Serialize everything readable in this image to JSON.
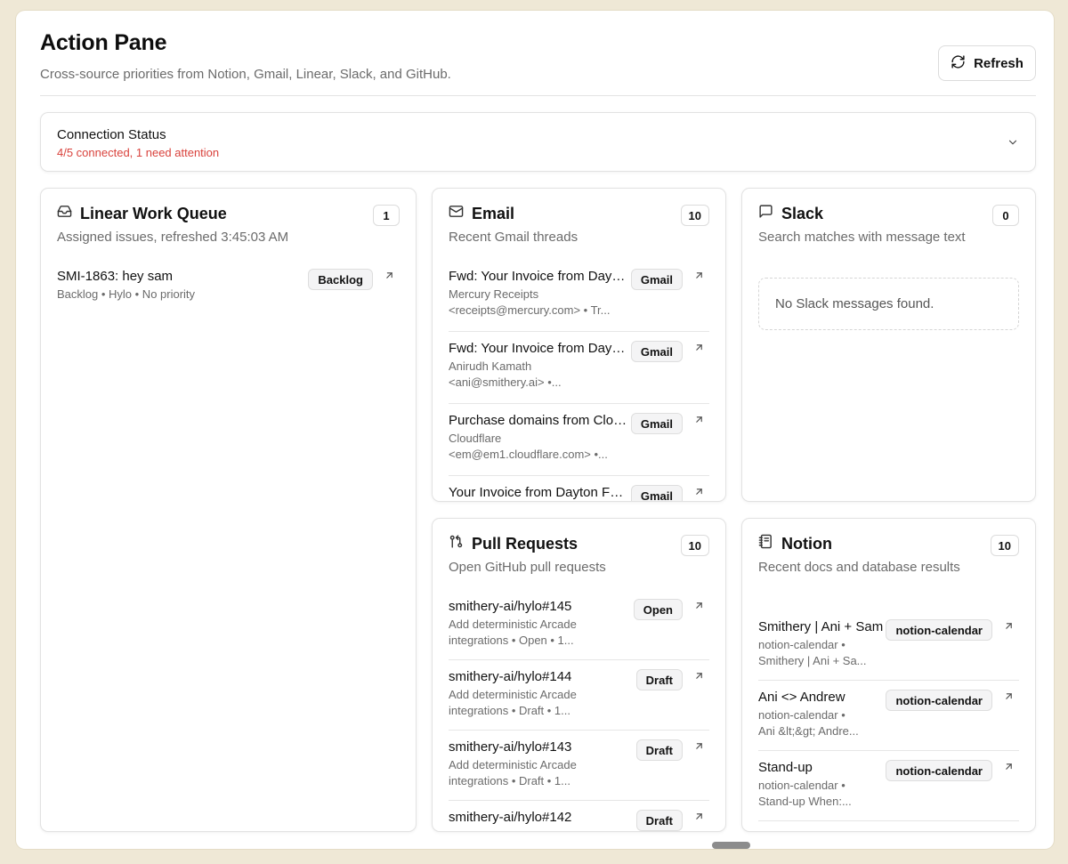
{
  "header": {
    "title": "Action Pane",
    "subtitle": "Cross-source priorities from Notion, Gmail, Linear, Slack, and GitHub.",
    "refresh_label": "Refresh"
  },
  "connection": {
    "title": "Connection Status",
    "status": "4/5 connected, 1 need attention",
    "status_color": "#d9423c"
  },
  "linear": {
    "title": "Linear Work Queue",
    "subtitle": "Assigned issues, refreshed 3:45:03 AM",
    "count": "1",
    "icon": "inbox-icon",
    "items": [
      {
        "title": "SMI-1863: hey sam",
        "meta": "Backlog • Hylo • No priority",
        "tag": "Backlog"
      }
    ]
  },
  "email": {
    "title": "Email",
    "subtitle": "Recent Gmail threads",
    "count": "10",
    "icon": "mail-icon",
    "items": [
      {
        "title": "Fwd: Your Invoice from Dayton Freight",
        "meta1": "Mercury Receipts",
        "meta2": "<receipts@mercury.com> • Tr...",
        "tag": "Gmail"
      },
      {
        "title": "Fwd: Your Invoice from Dayton Freight",
        "meta1": "Anirudh Kamath",
        "meta2": "<ani@smithery.ai> •...",
        "tag": "Gmail"
      },
      {
        "title": "Purchase domains from Cloudflare",
        "meta1": "Cloudflare",
        "meta2": "<em@em1.cloudflare.com> •...",
        "tag": "Gmail"
      },
      {
        "title": "Your Invoice from Dayton Freight",
        "meta1": "",
        "meta2": "",
        "tag": "Gmail"
      }
    ]
  },
  "slack": {
    "title": "Slack",
    "subtitle": "Search matches with message text",
    "count": "0",
    "icon": "message-square-icon",
    "empty": "No Slack messages found."
  },
  "pulls": {
    "title": "Pull Requests",
    "subtitle": "Open GitHub pull requests",
    "count": "10",
    "icon": "git-pull-request-icon",
    "items": [
      {
        "title": "smithery-ai/hylo#145",
        "meta1": "Add deterministic Arcade",
        "meta2": "integrations • Open • 1...",
        "tag": "Open"
      },
      {
        "title": "smithery-ai/hylo#144",
        "meta1": "Add deterministic Arcade",
        "meta2": "integrations • Draft • 1...",
        "tag": "Draft"
      },
      {
        "title": "smithery-ai/hylo#143",
        "meta1": "Add deterministic Arcade",
        "meta2": "integrations • Draft • 1...",
        "tag": "Draft"
      },
      {
        "title": "smithery-ai/hylo#142",
        "meta1": "",
        "meta2": "",
        "tag": "Draft"
      }
    ]
  },
  "notion": {
    "title": "Notion",
    "subtitle": "Recent docs and database results",
    "count": "10",
    "icon": "notebook-icon",
    "items": [
      {
        "title": "Smithery | Ani + Sam",
        "meta1": "notion-calendar •",
        "meta2": "Smithery | Ani + Sa...",
        "tag": "notion-calendar"
      },
      {
        "title": "Ani <> Andrew",
        "meta1": "notion-calendar •",
        "meta2": "Ani &lt;&gt; Andre...",
        "tag": "notion-calendar"
      },
      {
        "title": "Stand-up",
        "meta1": "notion-calendar •",
        "meta2": "Stand-up When:...",
        "tag": "notion-calendar"
      },
      {
        "title": "",
        "meta1": "",
        "meta2": "",
        "tag": ""
      }
    ]
  }
}
